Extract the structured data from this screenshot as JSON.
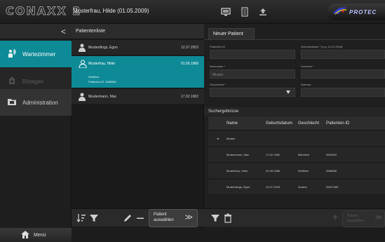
{
  "app": {
    "brand": "CONAXX 2",
    "current_patient": "Musterfrau, Hilde  (01.05.2009)",
    "logo_text": "PROTEC",
    "colors": {
      "accent": "#0d8a96",
      "background": "#232323"
    }
  },
  "leftnav": {
    "collapse_glyph": "<",
    "items": [
      {
        "label": "Wartezimmer",
        "icon": "waiting-room-icon",
        "active": true
      },
      {
        "label": "Röntgen",
        "icon": "xray-icon",
        "active": false
      },
      {
        "label": "Administration",
        "icon": "folder-icon",
        "active": false
      }
    ],
    "menu_label": "Menü"
  },
  "patient_list": {
    "title": "Patientenliste",
    "rows": [
      {
        "name": "Musterdings, Egon",
        "date": "12.07.2003"
      },
      {
        "name": "Musterfrau, Hilde",
        "date": "01.05.1966",
        "sex": "Weiblich",
        "patient_id": "Patienten-ID: ID88556"
      },
      {
        "name": "Mustermann, Max",
        "date": "17.02.1982"
      }
    ],
    "select_button": {
      "line1": "Patient",
      "line2": "auswählen",
      "arrow": "≫"
    }
  },
  "new_patient": {
    "tab": "Neuer Patient",
    "fields": {
      "patient_id_label": "Patienten-ID",
      "patient_id_value": "",
      "birthdate_label": "Geburtsdatum * (e.g. 24.12.2018)",
      "birthdate_value": "",
      "lastname_label": "Nachname *",
      "lastname_value": "Muster",
      "firstname_label": "Vorname *",
      "firstname_value": "",
      "sex_label": "Geschlecht *",
      "sex_value": "",
      "address_label": "Adresse",
      "address_value": ""
    },
    "results": {
      "title": "Suchergebnisse",
      "columns": [
        "Name",
        "Geburtsdatum",
        "Geschlecht",
        "Patienten-ID"
      ],
      "new_row": {
        "name": "Muster"
      },
      "rows": [
        {
          "name": "Mustermann, Max",
          "birthdate": "17.02.1982",
          "sex": "Männlich",
          "id": "ID54542"
        },
        {
          "name": "Musterfrau, Hilde",
          "birthdate": "01.05.1966",
          "sex": "Weiblich",
          "id": "ID88556"
        },
        {
          "name": "Musterdings, Egon",
          "birthdate": "12.07.2003",
          "sex": "Andere",
          "id": "ID537465"
        }
      ]
    },
    "select_button": {
      "line1": "Patient",
      "line2": "auswählen",
      "arrow": "≫"
    },
    "plus_glyph": "+"
  }
}
